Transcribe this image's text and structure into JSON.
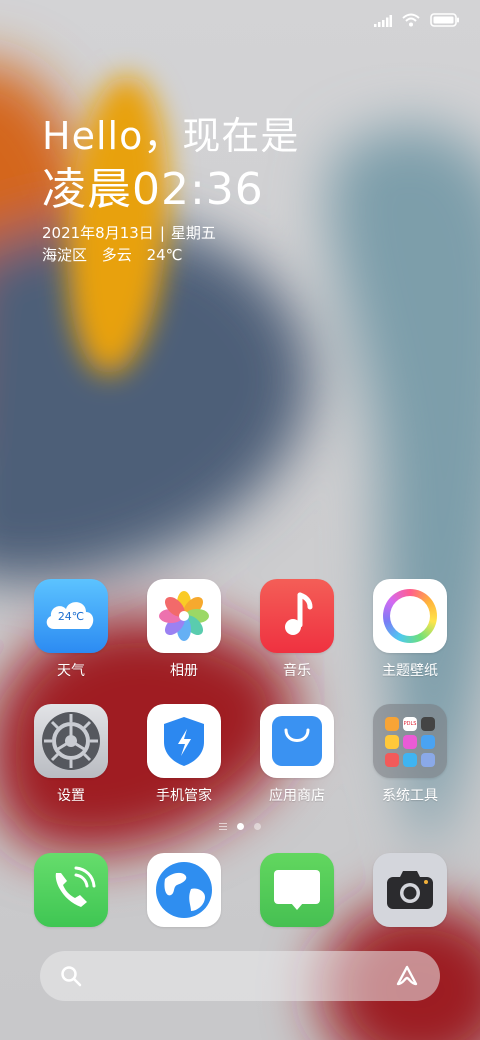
{
  "status_bar": {
    "icons": [
      "cellular-signal-icon",
      "wifi-icon",
      "battery-icon"
    ]
  },
  "clock_widget": {
    "greeting": "Hello，现在是",
    "time": "凌晨02:36",
    "date": "2021年8月13日",
    "separator": "|",
    "weekday": "星期五",
    "district": "海淀区",
    "weather": "多云",
    "temperature": "24℃"
  },
  "home_apps": [
    {
      "label": "天气",
      "icon": "weather-icon",
      "badge": "24℃"
    },
    {
      "label": "相册",
      "icon": "photos-icon"
    },
    {
      "label": "音乐",
      "icon": "music-icon"
    },
    {
      "label": "主题壁纸",
      "icon": "themes-icon"
    },
    {
      "label": "设置",
      "icon": "settings-gear-icon"
    },
    {
      "label": "手机管家",
      "icon": "security-shield-icon"
    },
    {
      "label": "应用商店",
      "icon": "app-store-bag-icon"
    },
    {
      "label": "系统工具",
      "icon": "system-tools-folder-icon",
      "folder_badge": "PDLS"
    }
  ],
  "page_indicator": {
    "pages": 2,
    "current_page": 1
  },
  "dock": [
    {
      "name": "phone",
      "icon": "phone-icon"
    },
    {
      "name": "browser",
      "icon": "browser-globe-icon"
    },
    {
      "name": "messages",
      "icon": "message-icon"
    },
    {
      "name": "camera",
      "icon": "camera-icon"
    }
  ],
  "search_bar": {
    "icon": "search-icon",
    "assistant_icon": "assistant-icon"
  },
  "colors": {
    "weather_top": "#5cc3ff",
    "weather_bottom": "#2c8bf2",
    "music": "#f4434d",
    "phone": "#4ad15e",
    "messages": "#52c95e",
    "settings": "#6f7278",
    "security": "#2c88f0",
    "store": "#3a92f2",
    "camera_bg": "#d4d6dc"
  }
}
